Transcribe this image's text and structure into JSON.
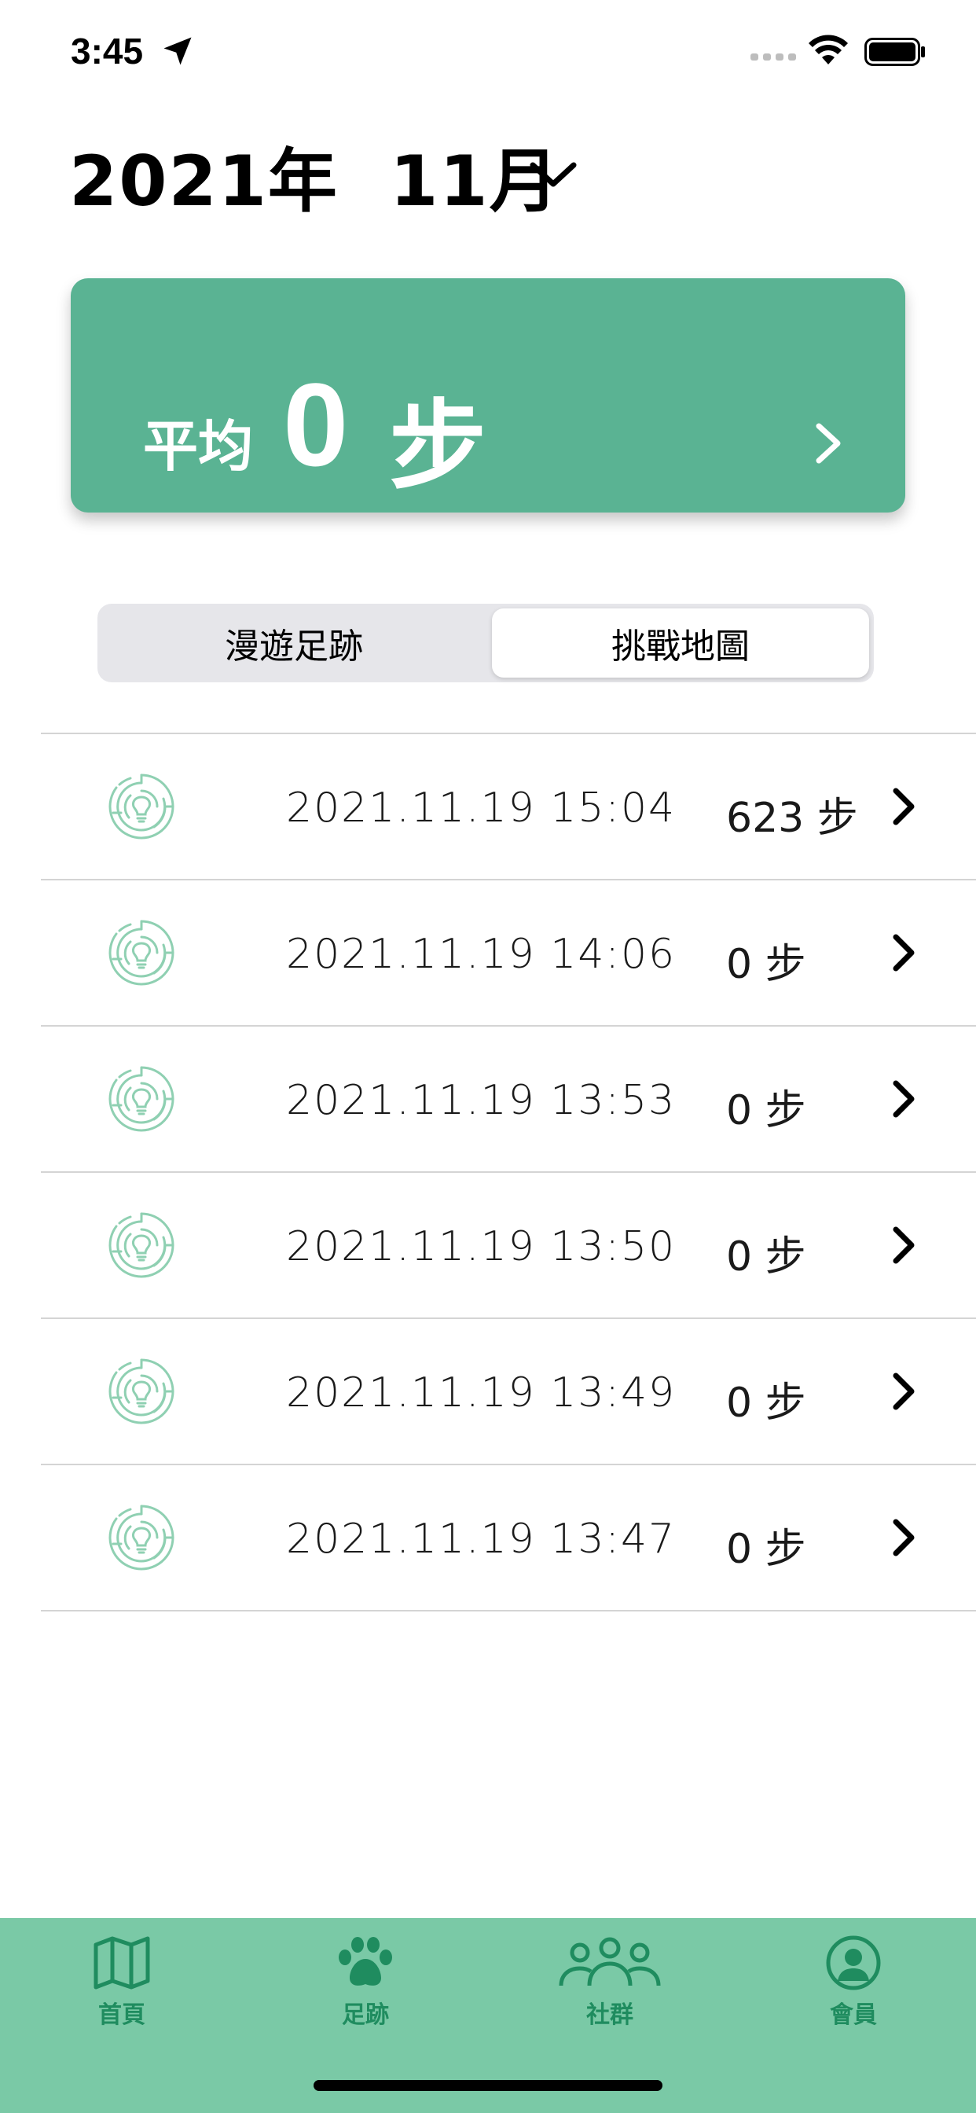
{
  "status_bar": {
    "time": "3:45"
  },
  "header": {
    "month_title": "2021年  11月"
  },
  "summary": {
    "avg_label": "平均",
    "avg_value": "0",
    "avg_unit": "步"
  },
  "segments": [
    {
      "label": "漫遊足跡",
      "selected": false
    },
    {
      "label": "挑戰地圖",
      "selected": true
    }
  ],
  "records": [
    {
      "datetime": "2021.11.19 15:04",
      "steps": "623 步"
    },
    {
      "datetime": "2021.11.19 14:06",
      "steps": "0 步"
    },
    {
      "datetime": "2021.11.19 13:53",
      "steps": "0 步"
    },
    {
      "datetime": "2021.11.19 13:50",
      "steps": "0 步"
    },
    {
      "datetime": "2021.11.19 13:49",
      "steps": "0 步"
    },
    {
      "datetime": "2021.11.19 13:47",
      "steps": "0 步"
    }
  ],
  "tab_bar": {
    "items": [
      {
        "label": "首頁",
        "icon": "map-icon"
      },
      {
        "label": "足跡",
        "icon": "paw-icon",
        "active": true
      },
      {
        "label": "社群",
        "icon": "group-icon"
      },
      {
        "label": "會員",
        "icon": "member-icon"
      }
    ]
  },
  "colors": {
    "card_green": "#5ab393",
    "tab_bar_green": "#7ac9a6",
    "tab_label_green": "#1f8c5f",
    "maze_icon_green": "#8fd0b2"
  }
}
